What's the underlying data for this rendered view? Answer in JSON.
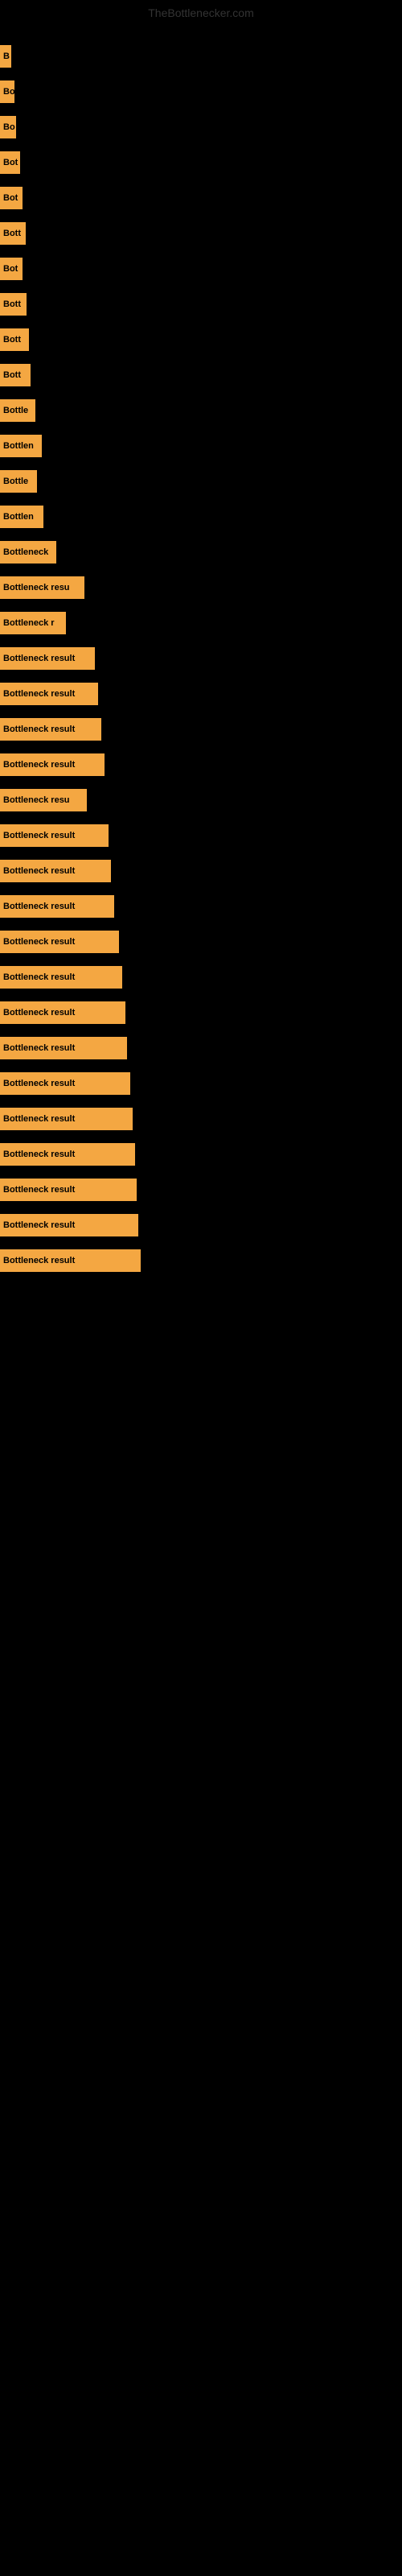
{
  "site": {
    "title": "TheBottlenecker.com"
  },
  "bars": [
    {
      "id": 1,
      "label": "B",
      "width": 14
    },
    {
      "id": 2,
      "label": "Bo",
      "width": 18
    },
    {
      "id": 3,
      "label": "Bo",
      "width": 20
    },
    {
      "id": 4,
      "label": "Bot",
      "width": 25
    },
    {
      "id": 5,
      "label": "Bot",
      "width": 28
    },
    {
      "id": 6,
      "label": "Bott",
      "width": 32
    },
    {
      "id": 7,
      "label": "Bot",
      "width": 28
    },
    {
      "id": 8,
      "label": "Bott",
      "width": 33
    },
    {
      "id": 9,
      "label": "Bott",
      "width": 36
    },
    {
      "id": 10,
      "label": "Bott",
      "width": 38
    },
    {
      "id": 11,
      "label": "Bottle",
      "width": 44
    },
    {
      "id": 12,
      "label": "Bottlen",
      "width": 52
    },
    {
      "id": 13,
      "label": "Bottle",
      "width": 46
    },
    {
      "id": 14,
      "label": "Bottlen",
      "width": 54
    },
    {
      "id": 15,
      "label": "Bottleneck",
      "width": 70
    },
    {
      "id": 16,
      "label": "Bottleneck resu",
      "width": 105
    },
    {
      "id": 17,
      "label": "Bottleneck r",
      "width": 82
    },
    {
      "id": 18,
      "label": "Bottleneck result",
      "width": 118
    },
    {
      "id": 19,
      "label": "Bottleneck result",
      "width": 122
    },
    {
      "id": 20,
      "label": "Bottleneck result",
      "width": 126
    },
    {
      "id": 21,
      "label": "Bottleneck result",
      "width": 130
    },
    {
      "id": 22,
      "label": "Bottleneck resu",
      "width": 108
    },
    {
      "id": 23,
      "label": "Bottleneck result",
      "width": 135
    },
    {
      "id": 24,
      "label": "Bottleneck result",
      "width": 138
    },
    {
      "id": 25,
      "label": "Bottleneck result",
      "width": 142
    },
    {
      "id": 26,
      "label": "Bottleneck result",
      "width": 148
    },
    {
      "id": 27,
      "label": "Bottleneck result",
      "width": 152
    },
    {
      "id": 28,
      "label": "Bottleneck result",
      "width": 156
    },
    {
      "id": 29,
      "label": "Bottleneck result",
      "width": 158
    },
    {
      "id": 30,
      "label": "Bottleneck result",
      "width": 162
    },
    {
      "id": 31,
      "label": "Bottleneck result",
      "width": 165
    },
    {
      "id": 32,
      "label": "Bottleneck result",
      "width": 168
    },
    {
      "id": 33,
      "label": "Bottleneck result",
      "width": 170
    },
    {
      "id": 34,
      "label": "Bottleneck result",
      "width": 172
    },
    {
      "id": 35,
      "label": "Bottleneck result",
      "width": 175
    }
  ]
}
